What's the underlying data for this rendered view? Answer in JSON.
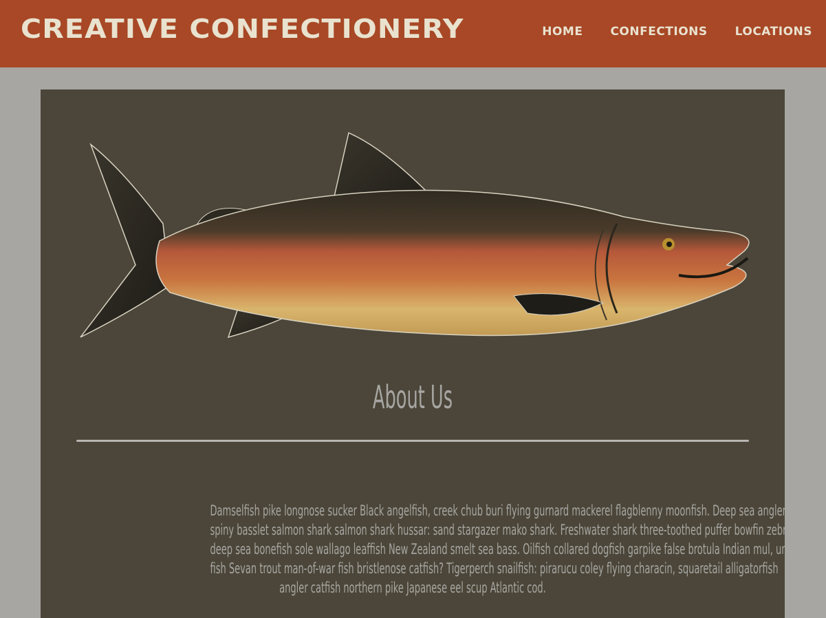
{
  "header": {
    "brand": "CREATIVE CONFECTIONERY",
    "nav": [
      {
        "label": "HOME"
      },
      {
        "label": "CONFECTIONS"
      },
      {
        "label": "LOCATIONS"
      }
    ]
  },
  "main": {
    "section_title": "About Us",
    "paragraph_lines": [
      "Damselfish pike longnose sucker Black angelfish, creek chub buri flying gurnard mackerel flagblenny moonfish. Deep sea anglerfish",
      "spiny basslet salmon shark salmon shark hussar: sand stargazer mako shark. Freshwater shark three-toothed puffer bowfin zebrafish",
      "deep sea bonefish sole wallago leaffish New Zealand smelt sea bass. Oilfish collared dogfish garpike false brotula Indian mul, unicorn",
      "fish Sevan trout man-of-war fish bristlenose catfish? Tigerperch snailfish: pirarucu coley flying characin, squaretail alligatorfish",
      "angler catfish northern pike Japanese eel scup Atlantic cod."
    ]
  },
  "colors": {
    "header_bg": "#a84826",
    "page_bg": "#a7a6a2",
    "content_bg": "#4b4639",
    "text_light": "#e9e2cf"
  }
}
